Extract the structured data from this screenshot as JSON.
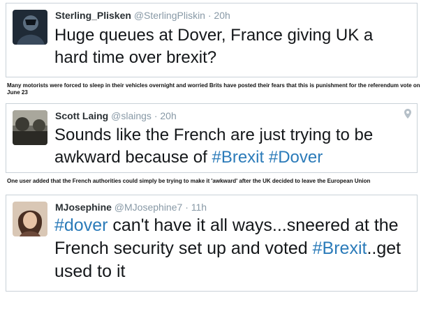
{
  "tweets": [
    {
      "name": "Sterling_Plisken",
      "handle": "@SterlingPliskin",
      "separator": "·",
      "time": "20h",
      "text": "Huge queues at Dover, France giving UK a hard time over brexit?"
    },
    {
      "name": "Scott Laing",
      "handle": "@slaings",
      "separator": "·",
      "time": "20h",
      "text_before": "Sounds like the French are just trying to be awkward because of ",
      "hashtag1": "#Brexit",
      "space": " ",
      "hashtag2": "#Dover",
      "location_icon": "map-pin-icon"
    },
    {
      "name": "MJosephine",
      "handle": "@MJosephine7",
      "separator": "·",
      "time": "11h",
      "hashtag1": "#dover",
      "text_middle": " can't have it all ways...sneered at the French security set up and voted ",
      "hashtag2": "#Brexit",
      "text_end": "..get used to it"
    }
  ],
  "captions": [
    "Many motorists were  forced to sleep in their vehicles overnight and worried Brits have posted their fears that this is punishment for the referendum vote on June 23",
    "One user added that the French authorities could simply be trying to make it 'awkward' after the UK decided to leave the European Union"
  ],
  "colors": {
    "hashtag": "#2b7bb9",
    "meta": "#8899a6",
    "border": "#c9d1d8"
  }
}
